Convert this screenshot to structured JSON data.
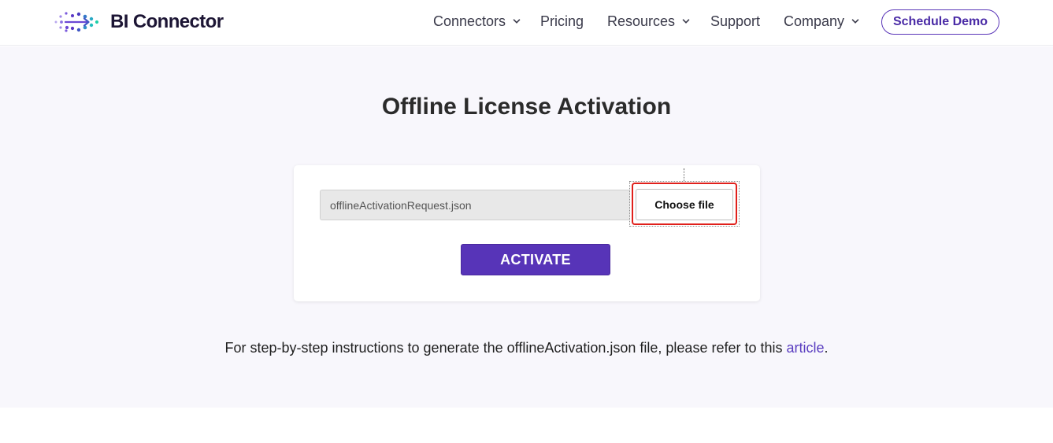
{
  "header": {
    "logo_text": "BI Connector",
    "nav": [
      {
        "label": "Connectors",
        "has_dropdown": true
      },
      {
        "label": "Pricing",
        "has_dropdown": false
      },
      {
        "label": "Resources",
        "has_dropdown": true
      },
      {
        "label": "Support",
        "has_dropdown": false
      },
      {
        "label": "Company",
        "has_dropdown": true
      }
    ],
    "cta_label": "Schedule Demo"
  },
  "main": {
    "title": "Offline License Activation",
    "file_input_value": "offlineActivationRequest.json",
    "choose_file_label": "Choose file",
    "activate_label": "ACTIVATE",
    "instructions": {
      "prefix": "For step-by-step instructions to generate the offlineActivation.json file, please refer to this ",
      "link_text": "article",
      "suffix": "."
    }
  },
  "colors": {
    "brand_purple": "#5734b8",
    "background": "#f8f7fc",
    "highlight_red": "#e0201b"
  },
  "icons": {
    "logo": "bi-connector-logo-icon",
    "dropdown": "chevron-down-icon"
  }
}
